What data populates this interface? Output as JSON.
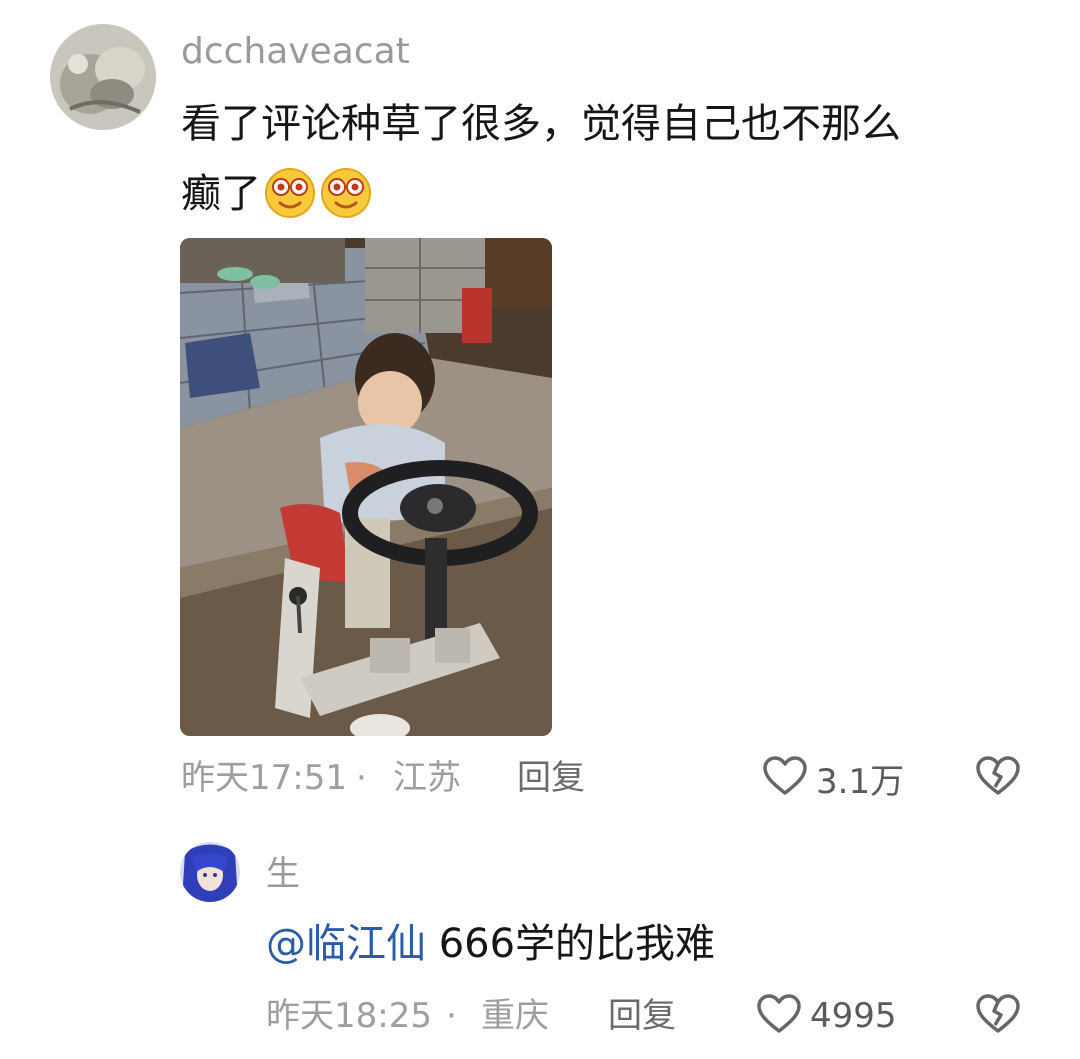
{
  "comment": {
    "username": "dcchaveacat",
    "text": "看了评论种草了很多，觉得自己也不那么",
    "text_line2": "癫了",
    "emoji_count": 2,
    "timestamp": "昨天17:51",
    "separator": "·",
    "location": "江苏",
    "reply_label": "回复",
    "like_count": "3.1万"
  },
  "reply": {
    "username": "生",
    "mention": "@临江仙",
    "text": " 666学的比我难",
    "timestamp": "昨天18:25",
    "separator": "·",
    "location": "重庆",
    "reply_label": "回复",
    "like_count": "4995"
  },
  "icons": {
    "like": "heart-outline-icon",
    "dislike": "broken-heart-icon",
    "emoji": "dizzy-smile-emoji"
  },
  "colors": {
    "username": "#9a9a9a",
    "mention": "#2a5da8",
    "meta": "#9e9e9e"
  }
}
